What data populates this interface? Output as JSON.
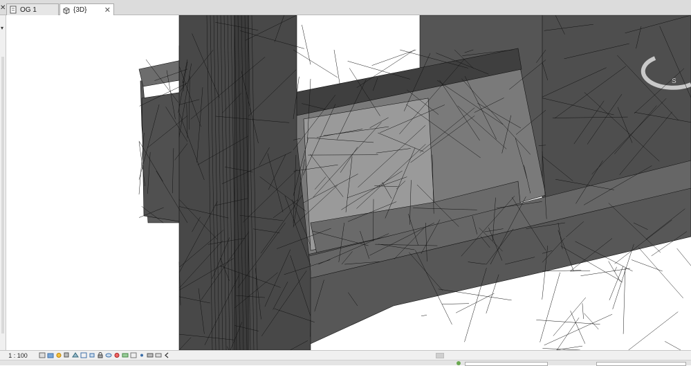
{
  "tabs": [
    {
      "label": "OG 1",
      "icon": "floor-plan-view-icon",
      "active": false
    },
    {
      "label": "{3D}",
      "icon": "3d-view-icon",
      "active": true
    }
  ],
  "status": {
    "scale": "1 : 100"
  },
  "view_cube": {
    "label": "S"
  },
  "colors": {
    "model_dark": "#4a4a4a",
    "model_mid": "#6b6b6b",
    "model_light": "#8a8a8a",
    "edge": "#111111",
    "tabbar": "#dcdcdc",
    "accent_green": "#6aa84f"
  }
}
